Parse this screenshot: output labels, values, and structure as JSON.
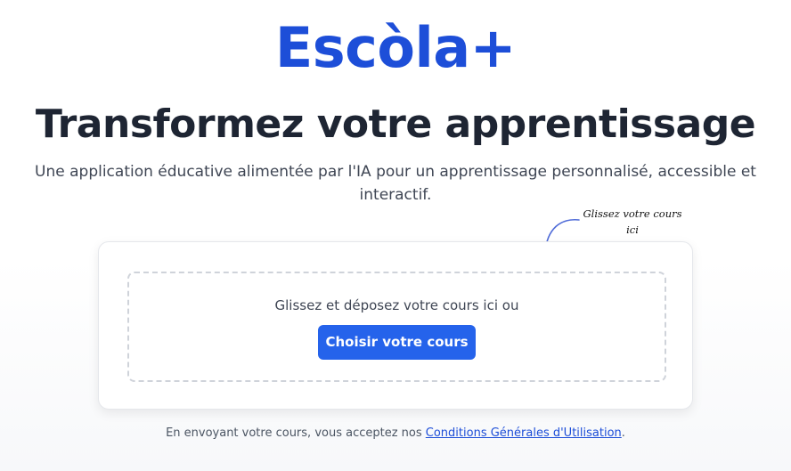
{
  "brand": {
    "logo_text": "Escòla+"
  },
  "hero": {
    "headline": "Transformez votre apprentissage",
    "subtitle": "Une application éducative alimentée par l'IA pour un apprentissage personnalisé, accessible et interactif."
  },
  "hint": {
    "line1": "Glissez votre cours",
    "line2": "ici",
    "arrow_icon": "curved-arrow-icon"
  },
  "upload": {
    "dropzone_text": "Glissez et déposez votre cours ici ou",
    "button_label": "Choisir votre cours"
  },
  "footer": {
    "terms_prefix": "En envoyant votre cours, vous acceptez nos ",
    "terms_link": "Conditions Générales d'Utilisation",
    "terms_suffix": "."
  },
  "colors": {
    "brand": "#1d4ed8",
    "button": "#2563eb",
    "headline": "#1e2533",
    "dropzone_border": "#cfd3da"
  }
}
